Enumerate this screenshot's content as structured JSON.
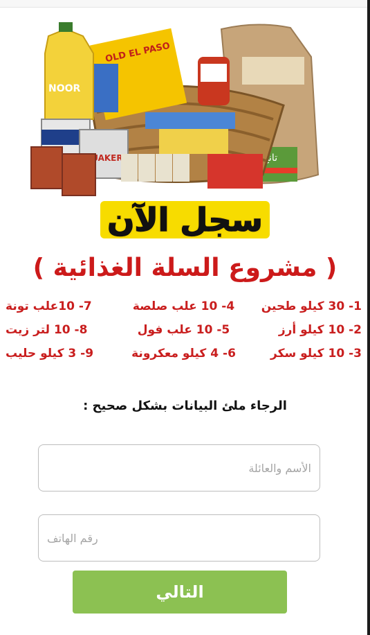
{
  "headline": "سجل الآن",
  "subheadline": "( مشروع السلة الغذائية )",
  "items": [
    {
      "label": "1- 30 كيلو طحين"
    },
    {
      "label": "4- 10 علب صلصة"
    },
    {
      "label": "7- 10علب تونة"
    },
    {
      "label": "2- 10 كيلو أرز"
    },
    {
      "label": "5- 10 علب فول"
    },
    {
      "label": "8- 10 لتر زيت"
    },
    {
      "label": "3- 10 كيلو سكر"
    },
    {
      "label": "6- 4 كيلو معكرونة"
    },
    {
      "label": "9- 3 كيلو حليب"
    }
  ],
  "form": {
    "prompt": "الرجاء ملئ البيانات بشكل صحيح :",
    "name_placeholder": "الأسم والعائلة",
    "phone_placeholder": "رقم الهاتف",
    "submit_label": "التالي"
  },
  "hero_image": {
    "brand_oil": "NOOR",
    "brand_box": "OLD EL PASO",
    "brand_can": "QUAKER",
    "brand_bag": "تانج"
  },
  "colors": {
    "headline_highlight": "#f7dc00",
    "subheadline": "#cc1a1a",
    "items": "#c91e1e",
    "button": "#8cc152"
  }
}
